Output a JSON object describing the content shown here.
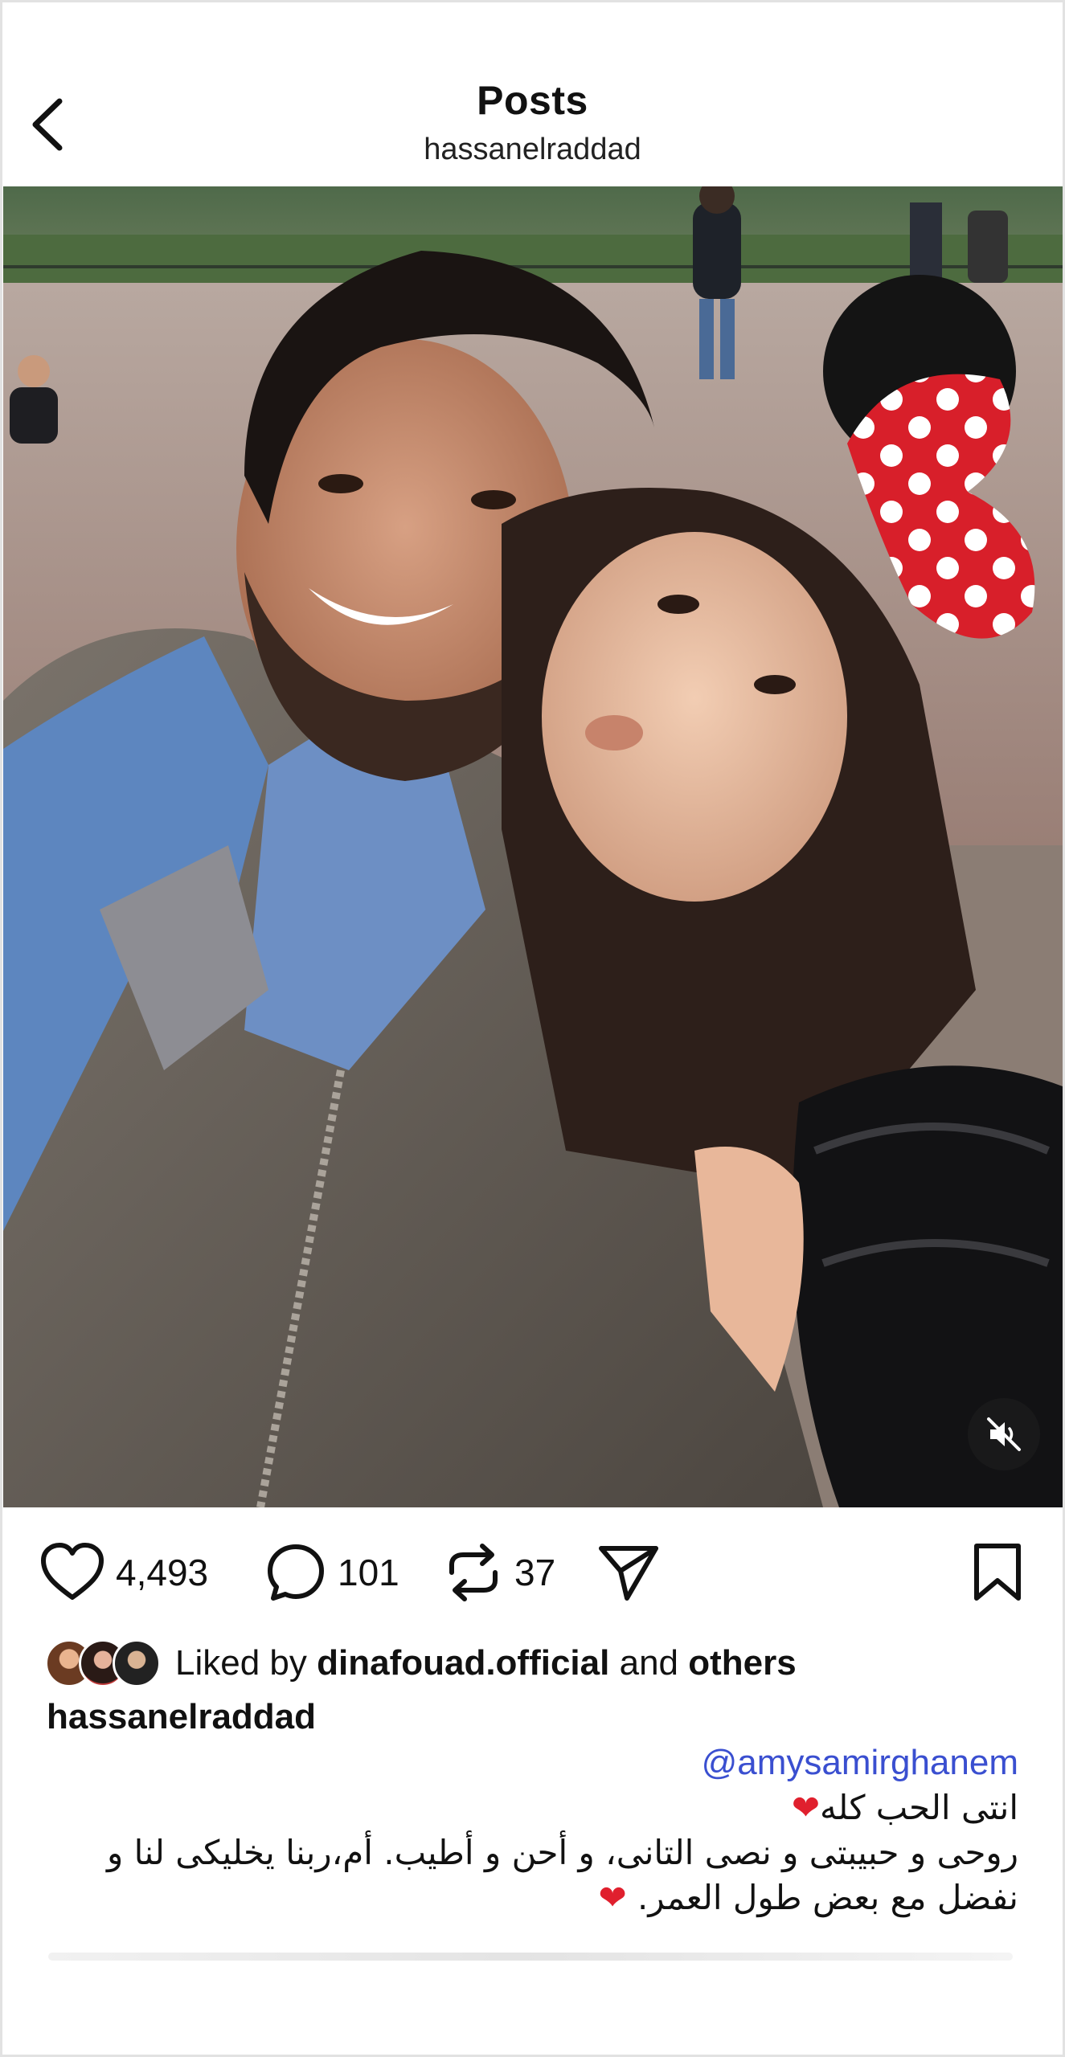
{
  "header": {
    "title": "Posts",
    "username": "hassanelraddad"
  },
  "media": {
    "kind": "video",
    "muted": true
  },
  "actions": {
    "likes": "4,493",
    "comments": "101",
    "reposts": "37"
  },
  "liked_by": {
    "prefix": "Liked by",
    "user": "dinafouad.official",
    "and": "and",
    "others": "others"
  },
  "post": {
    "author": "hassanelraddad",
    "mention": "@amysamirghanem",
    "line1": "انتى الحب كله",
    "line2": "روحى و حبيبتى و نصى التانى، و أحن و أطيب. أم،ربنا يخليكى لنا و نفضل مع بعض طول العمر."
  },
  "colors": {
    "mention": "#3a4fd0",
    "heart": "#e0202e"
  },
  "icons": [
    "chevron-left-icon",
    "heart-icon",
    "comment-icon",
    "repost-icon",
    "send-icon",
    "bookmark-icon",
    "mute-icon"
  ]
}
